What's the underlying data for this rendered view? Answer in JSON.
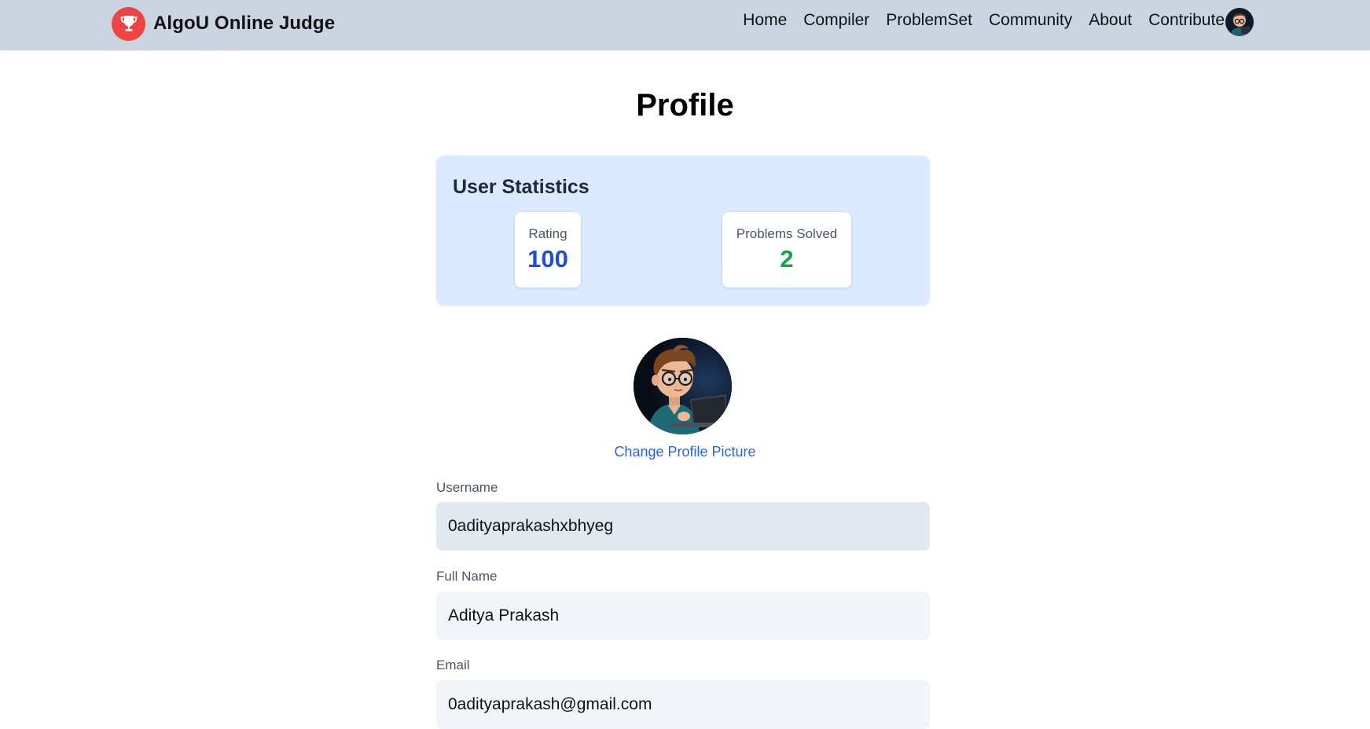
{
  "navbar": {
    "brand_name": "AlgoU Online Judge",
    "links": [
      "Home",
      "Compiler",
      "ProblemSet",
      "Community",
      "About",
      "Contribute"
    ]
  },
  "page": {
    "title": "Profile"
  },
  "stats": {
    "heading": "User Statistics",
    "rating_label": "Rating",
    "rating_value": "100",
    "solved_label": "Problems Solved",
    "solved_value": "2"
  },
  "profile": {
    "change_picture": "Change Profile Picture"
  },
  "form": {
    "username_label": "Username",
    "username_value": "0adityaprakashxbhyeg",
    "fullname_label": "Full Name",
    "fullname_value": "Aditya Prakash",
    "email_label": "Email",
    "email_value": "0adityaprakash@gmail.com"
  },
  "colors": {
    "navbar_bg": "#cbd5e1",
    "brand_logo": "#ef4444",
    "stats_bg": "#dbeafe",
    "rating_value": "#1d4ed8",
    "solved_value": "#16a34a",
    "link": "#2563eb"
  },
  "icons": {
    "brand": "trophy-icon",
    "avatar": "cartoon-developer-avatar"
  }
}
